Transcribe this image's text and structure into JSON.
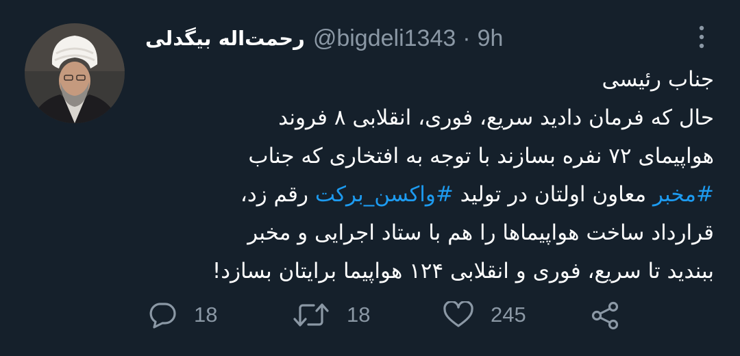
{
  "tweet": {
    "author": {
      "display_name": "رحمت‌اله بیگدلی",
      "handle": "@bigdeli1343"
    },
    "separator": "·",
    "time": "9h",
    "body": {
      "line1": "جناب رئیسی",
      "line2": "حال که فرمان دادید سریع، فوری، انقلابی ۸ فروند",
      "line3": "هواپیمای ۷۲ نفره بسازند با توجه به افتخاری که جناب",
      "line4_hashtag1": "#مخبر",
      "line4_mid": " معاون اولتان در تولید ",
      "line4_hashtag2": "#واکسن_برکت",
      "line4_end": " رقم زد،",
      "line5": "قرارداد ساخت هواپیماها را هم با ستاد اجرایی و مخبر",
      "line6": "ببندید تا سریع، فوری و انقلابی ۱۲۴ هواپیما برایتان بسازد!"
    },
    "actions": {
      "reply_count": "18",
      "retweet_count": "18",
      "like_count": "245"
    }
  },
  "colors": {
    "background": "#15202b",
    "text": "#ffffff",
    "muted": "#8b98a5",
    "link": "#1d9bf0"
  },
  "icons": {
    "more": "vertical-dots-icon",
    "reply": "speech-bubble-icon",
    "retweet": "retweet-arrows-icon",
    "like": "heart-icon",
    "share": "share-nodes-icon"
  }
}
